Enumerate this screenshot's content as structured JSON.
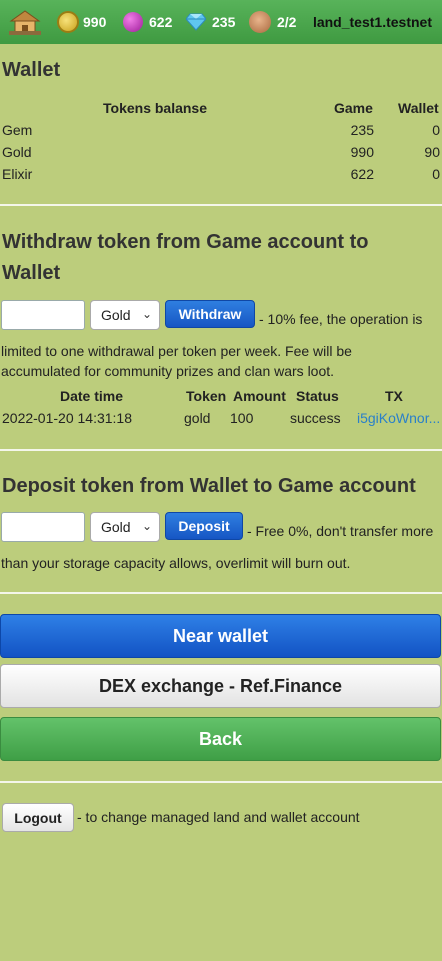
{
  "header": {
    "coins": "990",
    "elixir": "622",
    "gems": "235",
    "workers": "2/2",
    "account": "land_test1.testnet"
  },
  "wallet": {
    "title": "Wallet",
    "columns": [
      "Tokens balanse",
      "Game",
      "Wallet"
    ],
    "rows": [
      {
        "token": "Gem",
        "game": "235",
        "wallet": "0"
      },
      {
        "token": "Gold",
        "game": "990",
        "wallet": "90"
      },
      {
        "token": "Elixir",
        "game": "622",
        "wallet": "0"
      }
    ]
  },
  "withdraw": {
    "title_line1": "Withdraw token from Game account to",
    "title_line2": "Wallet",
    "select_value": "Gold",
    "button_label": "Withdraw",
    "note_line1": "- 10% fee, the operation is",
    "note_line2": "limited to one withdrawal per token per week. Fee will be",
    "note_line3": "accumulated for community prizes and clan wars loot.",
    "history_columns": [
      "Date time",
      "Token",
      "Amount",
      "Status",
      "TX"
    ],
    "history": [
      {
        "datetime": "2022-01-20 14:31:18",
        "token": "gold",
        "amount": "100",
        "status": "success",
        "tx": "i5giKoWnor..."
      }
    ]
  },
  "deposit": {
    "title": "Deposit token from Wallet to Game account",
    "select_value": "Gold",
    "button_label": "Deposit",
    "note_line1": "- Free 0%, don't transfer more",
    "note_line2": "than your storage capacity allows, overlimit will burn out."
  },
  "actions": {
    "near_wallet": "Near wallet",
    "dex": "DEX exchange - Ref.Finance",
    "back": "Back"
  },
  "logout": {
    "button_label": "Logout",
    "note": "- to change managed land and wallet account"
  }
}
